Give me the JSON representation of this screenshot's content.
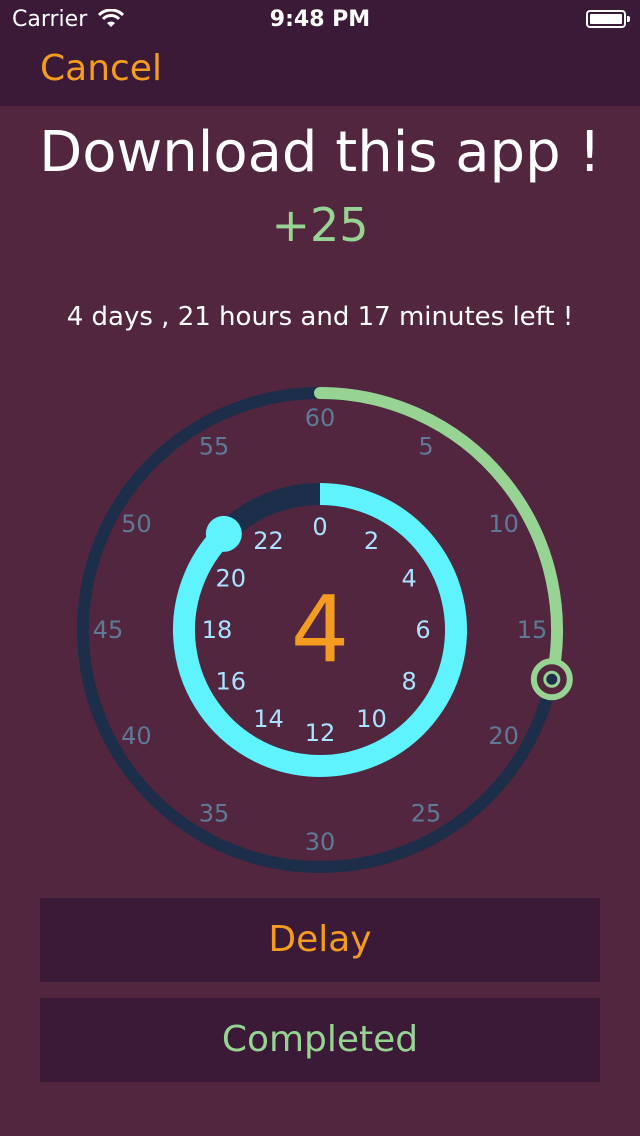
{
  "status_bar": {
    "carrier": "Carrier",
    "time": "9:48 PM",
    "wifi_icon": "wifi-icon",
    "battery_icon": "battery-icon"
  },
  "nav": {
    "cancel_label": "Cancel"
  },
  "task": {
    "title": "Download this app !",
    "points": "+25",
    "time_left": "4 days , 21 hours and 17 minutes left !"
  },
  "dial": {
    "center_value": "4",
    "minute_labels": [
      "60",
      "5",
      "10",
      "15",
      "20",
      "25",
      "30",
      "35",
      "40",
      "45",
      "50",
      "55"
    ],
    "hour_labels": [
      "0",
      "2",
      "4",
      "6",
      "8",
      "10",
      "12",
      "14",
      "16",
      "18",
      "20",
      "22"
    ],
    "minutes_value": 17,
    "minutes_total": 60,
    "hours_value": 21,
    "hours_total": 24
  },
  "actions": {
    "delay_label": "Delay",
    "completed_label": "Completed"
  },
  "colors": {
    "background": "#52263f",
    "bar_background": "#3a1a37",
    "accent_orange": "#f39c1f",
    "accent_green": "#97d493",
    "accent_cyan": "#5ef3ff",
    "ring_track": "#1c2e49",
    "minute_label": "#5f7a96",
    "hour_label": "#a9e3ff"
  }
}
